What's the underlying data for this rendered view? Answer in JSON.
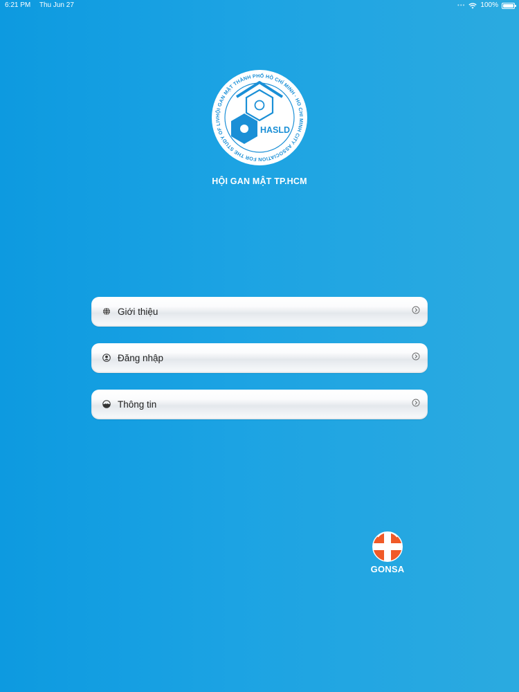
{
  "status_bar": {
    "time": "6:21 PM",
    "date": "Thu Jun 27",
    "battery": "100%"
  },
  "logo": {
    "abbreviation": "HASLD",
    "ring_text": "HỘI GAN MẬT THÀNH PHỐ HỒ CHÍ MINH · HO CHI MINH CITY ASSOCIATION FOR THE STUDY OF LIVER DISEASES"
  },
  "app": {
    "title": "HỘI GAN MẬT TP.HCM"
  },
  "menu": [
    {
      "label": "Giới thiệu",
      "icon": "globe-icon"
    },
    {
      "label": "Đăng nhập",
      "icon": "user-icon"
    },
    {
      "label": "Thông tin",
      "icon": "info-circle-icon"
    }
  ],
  "brand": {
    "name": "GONSA"
  },
  "colors": {
    "background": "#1ca3e3",
    "logo_blue": "#1a8fd6",
    "brand_orange": "#f05a28"
  }
}
